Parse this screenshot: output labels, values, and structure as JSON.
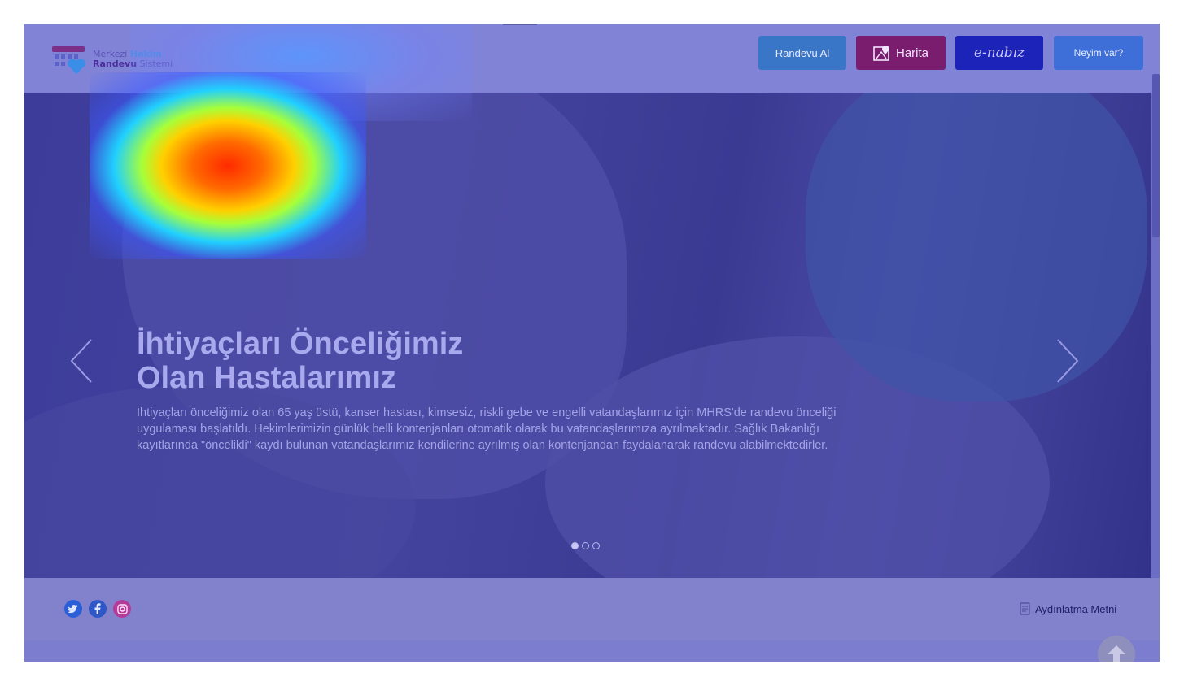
{
  "header": {
    "logo": {
      "line1_a": "Merkezi",
      "line1_b": "Hekim",
      "line2_a": "Randevu",
      "line2_b": "Sistemi"
    },
    "buttons": {
      "randevu": "Randevu Al",
      "harita": "Harita",
      "enabiz": "e-nabız",
      "neyim": "Neyim var?"
    }
  },
  "hero": {
    "title_lines": [
      "İhtiyaçları Önceliğimiz",
      "Olan Hastalarımız"
    ],
    "text_lines": [
      "İhtiyaçları önceliğimiz olan 65 yaş üstü, kanser hastası, kimsesiz, riskli gebe ve engelli vatandaşlarımız için MHRS'de randevu önceliği",
      "uygulaması başlatıldı. Hekimlerimizin günlük belli kontenjanları otomatik olarak bu vatandaşlarımıza ayrılmaktadır. Sağlık Bakanlığı",
      "kayıtlarında \"öncelikli\" kaydı bulunan vatandaşlarımız kendilerine ayrılmış olan kontenjandan faydalanarak randevu alabilmektedirler."
    ],
    "slides": {
      "count": 3,
      "active": 1
    }
  },
  "footer": {
    "social": [
      "twitter-icon",
      "facebook-icon",
      "instagram-icon"
    ],
    "aydinlatma": "Aydınlatma Metni"
  },
  "colors": {
    "randevu_button": "#3a76c8",
    "harita_button": "#7a1d6e",
    "enabiz_button": "#1b23b8",
    "neyim_button": "#3e6fd8"
  }
}
